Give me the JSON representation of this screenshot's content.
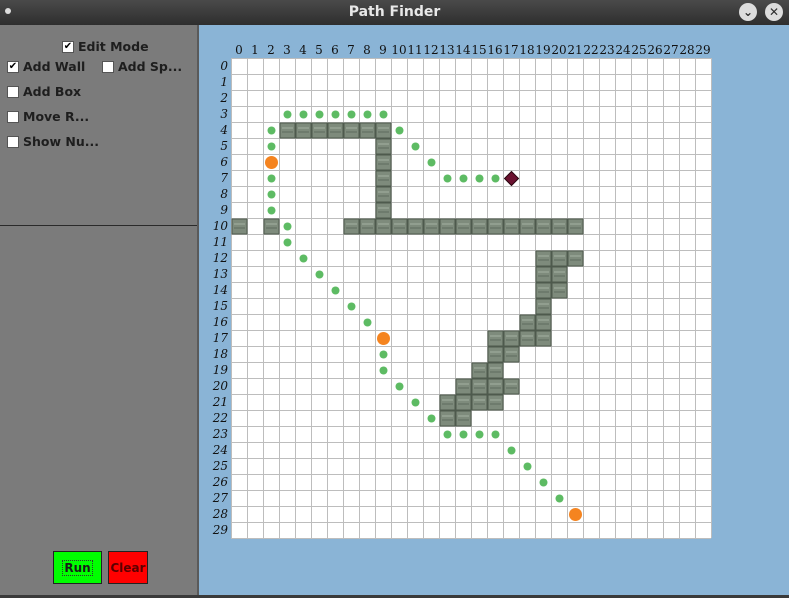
{
  "window": {
    "title": "Path Finder"
  },
  "options": {
    "edit_mode": {
      "label": "Edit Mode",
      "checked": true
    },
    "add_wall": {
      "label": "Add Wall",
      "checked": true
    },
    "add_special": {
      "label": "Add Sp...",
      "checked": false
    },
    "add_box": {
      "label": "Add Box",
      "checked": false
    },
    "move_robot": {
      "label": "Move R...",
      "checked": false
    },
    "show_numbers": {
      "label": "Show Nu...",
      "checked": false
    }
  },
  "buttons": {
    "run": "Run",
    "clear": "Clear"
  },
  "colors": {
    "wall": "#7e8b7c",
    "path": "#5dbb63",
    "waypoint": "#f5841f",
    "goal": "#6b1230",
    "run": "#00ff00",
    "clear": "#ff0000",
    "canvas": "#8ab4d6"
  },
  "grid": {
    "cols": 30,
    "rows": 30,
    "walls": [
      [
        3,
        4
      ],
      [
        4,
        4
      ],
      [
        5,
        4
      ],
      [
        6,
        4
      ],
      [
        7,
        4
      ],
      [
        8,
        4
      ],
      [
        9,
        4
      ],
      [
        9,
        5
      ],
      [
        9,
        6
      ],
      [
        9,
        7
      ],
      [
        9,
        8
      ],
      [
        9,
        9
      ],
      [
        0,
        10
      ],
      [
        2,
        10
      ],
      [
        7,
        10
      ],
      [
        8,
        10
      ],
      [
        9,
        10
      ],
      [
        10,
        10
      ],
      [
        11,
        10
      ],
      [
        12,
        10
      ],
      [
        13,
        10
      ],
      [
        14,
        10
      ],
      [
        15,
        10
      ],
      [
        16,
        10
      ],
      [
        17,
        10
      ],
      [
        18,
        10
      ],
      [
        19,
        10
      ],
      [
        20,
        10
      ],
      [
        21,
        10
      ],
      [
        19,
        12
      ],
      [
        20,
        12
      ],
      [
        21,
        12
      ],
      [
        19,
        13
      ],
      [
        20,
        13
      ],
      [
        19,
        14
      ],
      [
        20,
        14
      ],
      [
        19,
        15
      ],
      [
        18,
        16
      ],
      [
        19,
        16
      ],
      [
        16,
        17
      ],
      [
        17,
        17
      ],
      [
        18,
        17
      ],
      [
        19,
        17
      ],
      [
        16,
        18
      ],
      [
        17,
        18
      ],
      [
        15,
        19
      ],
      [
        16,
        19
      ],
      [
        14,
        20
      ],
      [
        15,
        20
      ],
      [
        16,
        20
      ],
      [
        17,
        20
      ],
      [
        13,
        21
      ],
      [
        14,
        21
      ],
      [
        15,
        21
      ],
      [
        16,
        21
      ],
      [
        13,
        22
      ],
      [
        14,
        22
      ]
    ],
    "path": [
      [
        3,
        3
      ],
      [
        4,
        3
      ],
      [
        5,
        3
      ],
      [
        6,
        3
      ],
      [
        7,
        3
      ],
      [
        8,
        3
      ],
      [
        9,
        3
      ],
      [
        2,
        4
      ],
      [
        10,
        4
      ],
      [
        2,
        5
      ],
      [
        11,
        5
      ],
      [
        12,
        6
      ],
      [
        2,
        7
      ],
      [
        13,
        7
      ],
      [
        14,
        7
      ],
      [
        15,
        7
      ],
      [
        16,
        7
      ],
      [
        2,
        8
      ],
      [
        2,
        9
      ],
      [
        3,
        10
      ],
      [
        3,
        11
      ],
      [
        4,
        12
      ],
      [
        5,
        13
      ],
      [
        6,
        14
      ],
      [
        7,
        15
      ],
      [
        8,
        16
      ],
      [
        9,
        18
      ],
      [
        9,
        19
      ],
      [
        10,
        20
      ],
      [
        11,
        21
      ],
      [
        12,
        22
      ],
      [
        13,
        23
      ],
      [
        14,
        23
      ],
      [
        15,
        23
      ],
      [
        16,
        23
      ],
      [
        17,
        24
      ],
      [
        18,
        25
      ],
      [
        19,
        26
      ],
      [
        20,
        27
      ]
    ],
    "waypoints": [
      [
        2,
        6
      ],
      [
        9,
        17
      ],
      [
        21,
        28
      ]
    ],
    "goal": [
      17,
      7
    ]
  }
}
